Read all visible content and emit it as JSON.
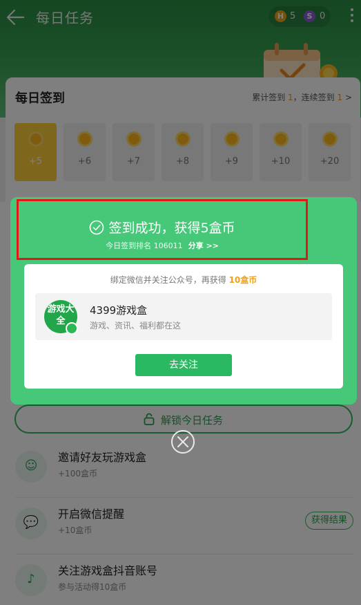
{
  "header": {
    "title": "每日任务",
    "h_coin_icon": "H",
    "h_coin_count": "5",
    "s_coin_icon": "S",
    "s_coin_count": "0"
  },
  "checkin": {
    "title": "每日签到",
    "stats_prefix": "累计签到 ",
    "total_days": "1",
    "stats_mid": "，连续签到 ",
    "streak_days": "1",
    "days": [
      "+5",
      "+6",
      "+7",
      "+8",
      "+9",
      "+10",
      "+20"
    ]
  },
  "modal": {
    "success_title": "签到成功，获得5盒币",
    "rank_text": "今日签到排名 106011",
    "share_label": "分享 >>",
    "bind_text": "绑定微信并关注公众号，再获得 ",
    "bind_reward": "10盒币",
    "logo_text": "游戏大全",
    "account_name": "4399游戏盒",
    "account_desc": "游戏、资讯、福利都在这",
    "follow_label": "去关注"
  },
  "tasks": {
    "unlock_label": "解锁今日任务",
    "items": [
      {
        "title": "邀请好友玩游戏盒",
        "sub": "+100盒币"
      },
      {
        "title": "开启微信提醒",
        "sub": "+10盒币",
        "action": "获得结果"
      },
      {
        "title": "关注游戏盒抖音账号",
        "sub": "参与活动得10盒币"
      }
    ]
  },
  "colors": {
    "brand_green": "#47c878",
    "header_green": "#2a8d43",
    "reward_orange": "#f0a019",
    "highlight_red": "#e01818"
  }
}
